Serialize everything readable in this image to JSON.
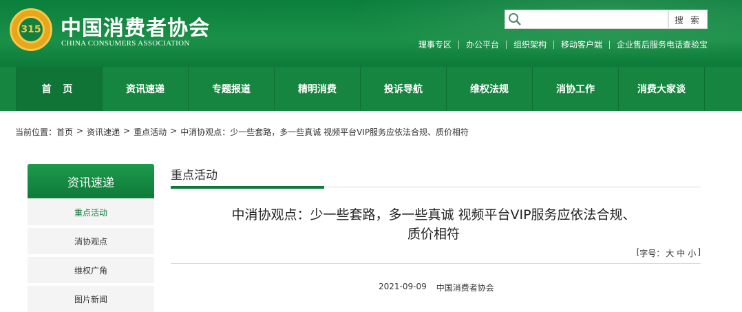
{
  "header": {
    "logo_text": "315",
    "brand_cn": "中国消费者协会",
    "brand_en": "CHINA CONSUMERS ASSOCIATION",
    "search": {
      "placeholder": "",
      "button_label": "搜 索"
    },
    "top_links": [
      "理事专区",
      "办公平台",
      "组织架构",
      "移动客户端",
      "企业售后服务电话查验宝"
    ],
    "colors": {
      "brand_green": "#16853f",
      "dark_green": "#0e7a39",
      "logo_gold": "#e8a61b"
    }
  },
  "nav": {
    "items": [
      "首 页",
      "资讯速递",
      "专题报道",
      "精明消费",
      "投诉导航",
      "维权法规",
      "消协工作",
      "消费大家谈"
    ]
  },
  "breadcrumb": {
    "prefix": "当前位置：",
    "items": [
      "首页",
      "资讯速递",
      "重点活动",
      "中消协观点：少一些套路，多一些真诚 视频平台VIP服务应依法合规、质价相符"
    ],
    "separator": ">"
  },
  "sidebar": {
    "title": "资讯速递",
    "items": [
      {
        "label": "重点活动",
        "active": true
      },
      {
        "label": "消协观点",
        "active": false
      },
      {
        "label": "维权广角",
        "active": false
      },
      {
        "label": "图片新闻",
        "active": false
      }
    ]
  },
  "main": {
    "section_title": "重点活动",
    "article_title_line1": "中消协观点：少一些套路，多一些真诚 视频平台VIP服务应依法合规、",
    "article_title_line2": "质价相符",
    "font_size": {
      "open": "[",
      "label": "字号：",
      "large": "大",
      "medium": "中",
      "small": "小",
      "close": "]"
    },
    "date": "2021-09-09",
    "source": "中国消费者协会"
  }
}
